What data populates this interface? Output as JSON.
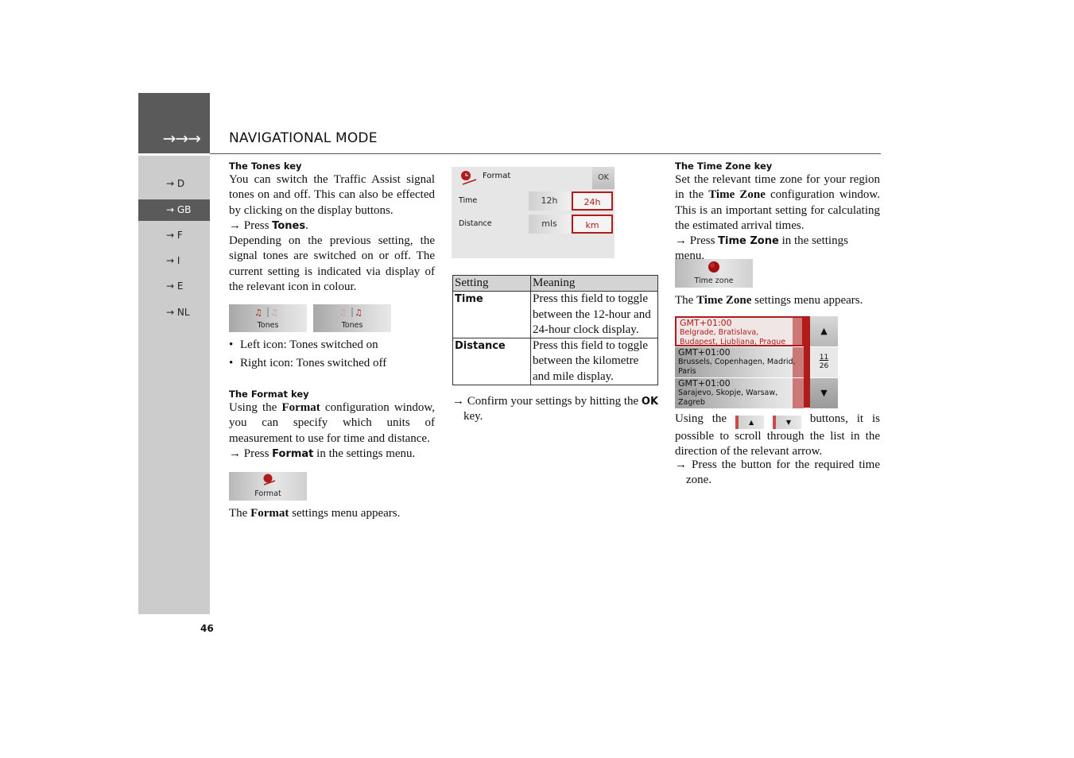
{
  "header": {
    "arrows": "→→→",
    "title": "NAVIGATIONAL MODE"
  },
  "sidebar": {
    "items": [
      {
        "label": "→ D",
        "active": false
      },
      {
        "label": "→ GB",
        "active": true
      },
      {
        "label": "→ F",
        "active": false
      },
      {
        "label": "→ I",
        "active": false
      },
      {
        "label": "→ E",
        "active": false
      },
      {
        "label": "→ NL",
        "active": false
      }
    ]
  },
  "page_number": "46",
  "col1": {
    "tones_heading": "The Tones key",
    "tones_para1": "You can switch the Traffic Assist signal tones on and off. This can also be effected by clicking on the display buttons.",
    "tones_press_prefix": "→ Press ",
    "tones_press_kw": "Tones",
    "tones_press_suffix": ".",
    "tones_para2": "Depending on the previous setting, the signal tones are switched on or off. The current setting is indicated via display of the relevant icon in colour.",
    "tones_button_label": "Tones",
    "bullets": [
      "Left icon: Tones switched on",
      "Right icon: Tones switched off"
    ],
    "format_heading": "The Format key",
    "format_para_a": "Using the ",
    "format_para_kw": "Format",
    "format_para_b": " configuration window, you can specify which units of measurement to use for time and distance.",
    "format_press_prefix": "→ Press ",
    "format_press_kw": "Format",
    "format_press_suffix": " in the settings menu.",
    "format_button_label": "Format",
    "format_appears_a": "The ",
    "format_appears_kw": "Format",
    "format_appears_b": " settings menu appears."
  },
  "col2": {
    "format_window": {
      "title": "Format",
      "ok": "OK",
      "rows": [
        {
          "label": "Time",
          "off": "12h",
          "on": "24h"
        },
        {
          "label": "Distance",
          "off": "mls",
          "on": "km"
        }
      ]
    },
    "table": {
      "headers": [
        "Setting",
        "Meaning"
      ],
      "rows": [
        {
          "setting": "Time",
          "meaning": "Press this field to toggle between the 12-hour and 24-hour clock display."
        },
        {
          "setting": "Distance",
          "meaning": "Press this field to toggle between the kilometre and mile display."
        }
      ]
    },
    "confirm_prefix": "→ Confirm your settings by hitting the ",
    "confirm_kw": "OK",
    "confirm_suffix": " key."
  },
  "col3": {
    "tz_heading": "The Time Zone key",
    "tz_para_a": "Set the relevant time zone for your region in the ",
    "tz_para_kw": "Time Zone",
    "tz_para_b": " configuration window. This is an important setting for calculating the estimated arrival times.",
    "tz_press_prefix": "→ Press ",
    "tz_press_kw": "Time Zone",
    "tz_press_suffix": " in the settings menu.",
    "tz_button_label": "Time zone",
    "tz_appears_a": "The ",
    "tz_appears_kw": "Time Zone",
    "tz_appears_b": " settings menu appears.",
    "tz_list": [
      {
        "gmt": "GMT+01:00",
        "cities": "Belgrade, Bratislava, Budapest, Ljubljana, Prague",
        "selected": true
      },
      {
        "gmt": "GMT+01:00",
        "cities": "Brussels, Copenhagen, Madrid, Paris",
        "selected": false
      },
      {
        "gmt": "GMT+01:00",
        "cities": "Sarajevo, Skopje, Warsaw, Zagreb",
        "selected": false
      }
    ],
    "scroll_up": "▲",
    "scroll_down": "▼",
    "page_current": "11",
    "page_total": "26",
    "using_a": "Using the",
    "using_b": "buttons, it is possible to scroll through the list in the direction of the relevant arrow.",
    "press_required": "→ Press the button for the required time zone."
  },
  "colors": {
    "accent_red": "#b01c1c",
    "header_dark": "#5a5a5a",
    "sidebar_gray": "#cccccc"
  }
}
